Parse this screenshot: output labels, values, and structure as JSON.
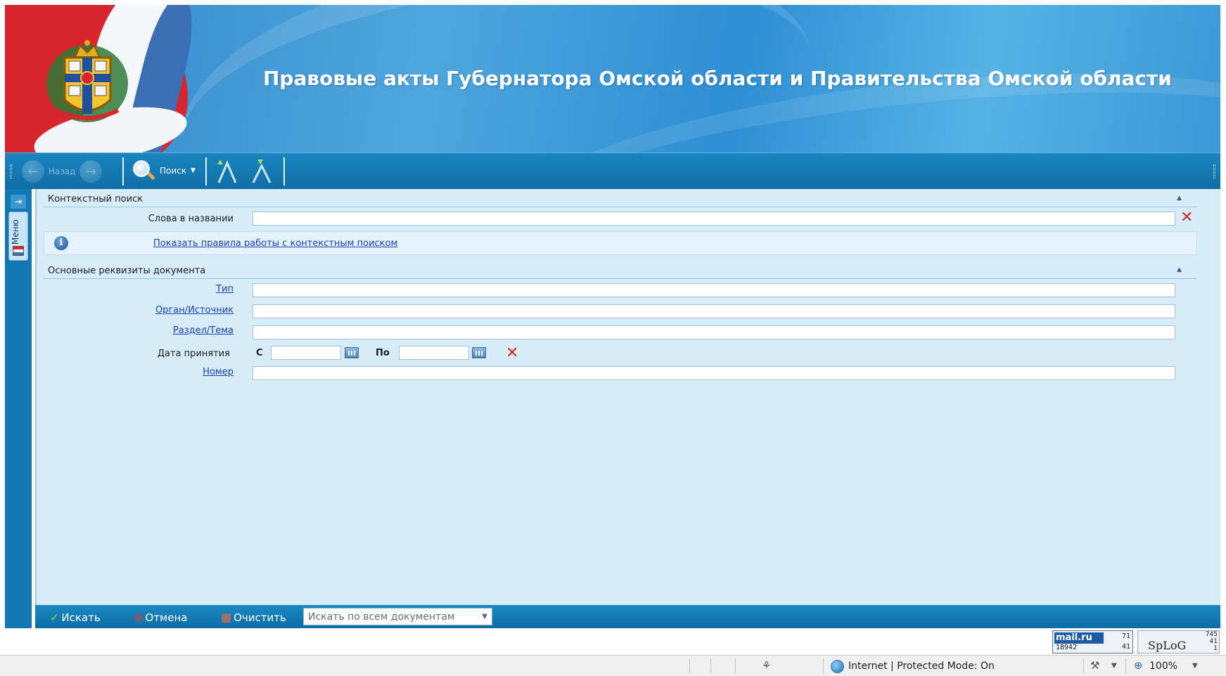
{
  "banner": {
    "title": "Правовые акты Губернатора Омской области и Правительства Омской области"
  },
  "toolbar": {
    "back_label": "Назад",
    "search_label": "Поиск"
  },
  "sidebar": {
    "menu_label": "Меню"
  },
  "context_search": {
    "header": "Контекстный поиск",
    "words_label": "Слова в названии",
    "words_value": "",
    "rules_link": "Показать правила работы с контекстным поиском"
  },
  "requisites": {
    "header": "Основные реквизиты документа",
    "type_label": "Тип",
    "type_value": "",
    "organ_label": "Орган/Источник",
    "organ_value": "",
    "section_label": "Раздел/Тема",
    "section_value": "",
    "date_label": "Дата принятия",
    "date_from_label": "С",
    "date_from_value": "",
    "date_to_label": "По",
    "date_to_value": "",
    "number_label": "Номер",
    "number_value": ""
  },
  "actions": {
    "search_label": "Искать",
    "cancel_label": "Отмена",
    "clear_label": "Очистить",
    "scope_selected": "Искать по всем документам"
  },
  "counters": {
    "mailru_logo": "mail.ru",
    "mailru_total": "18942",
    "mailru_top": "71",
    "mailru_bottom": "41",
    "splog_logo": "SpLoG",
    "splog_n1": "745",
    "splog_n2": "41",
    "splog_n3": "1"
  },
  "statusbar": {
    "zone": "Internet | Protected Mode: On",
    "zoom": "100%"
  }
}
